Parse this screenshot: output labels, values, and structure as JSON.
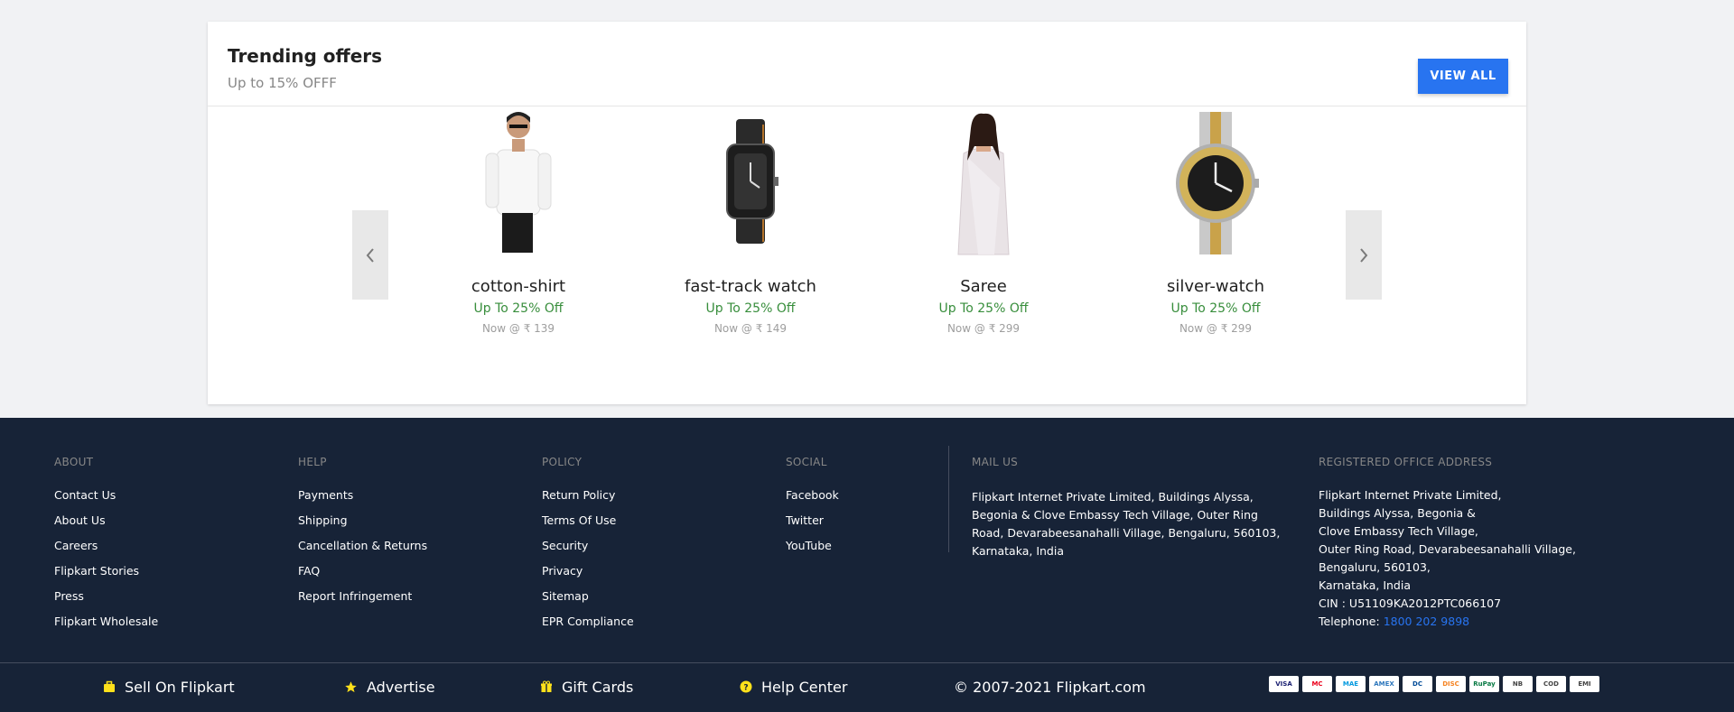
{
  "trending": {
    "title": "Trending offers",
    "subtitle": "Up to 15% OFFF",
    "view_all": "VIEW ALL",
    "products": [
      {
        "name": "cotton-shirt",
        "offer": "Up To 25% Off",
        "price": "Now @ ₹ 139"
      },
      {
        "name": "fast-track watch",
        "offer": "Up To 25% Off",
        "price": "Now @ ₹ 149"
      },
      {
        "name": "Saree",
        "offer": "Up To 25% Off",
        "price": "Now @ ₹ 299"
      },
      {
        "name": "silver-watch",
        "offer": "Up To 25% Off",
        "price": "Now @ ₹ 299"
      }
    ]
  },
  "footer": {
    "about": {
      "heading": "ABOUT",
      "links": [
        "Contact Us",
        "About Us",
        "Careers",
        "Flipkart Stories",
        "Press",
        "Flipkart Wholesale"
      ]
    },
    "help": {
      "heading": "HELP",
      "links": [
        "Payments",
        "Shipping",
        "Cancellation & Returns",
        "FAQ",
        "Report Infringement"
      ]
    },
    "policy": {
      "heading": "POLICY",
      "links": [
        "Return Policy",
        "Terms Of Use",
        "Security",
        "Privacy",
        "Sitemap",
        "EPR Compliance"
      ]
    },
    "social": {
      "heading": "SOCIAL",
      "links": [
        "Facebook",
        "Twitter",
        "YouTube"
      ]
    },
    "mail": {
      "heading": "MAIL US",
      "lines": [
        "Flipkart Internet Private Limited, Buildings Alyssa,",
        "Begonia & Clove Embassy Tech Village, Outer Ring",
        "Road, Devarabeesanahalli Village, Bengaluru, 560103,",
        "Karnataka, India"
      ]
    },
    "office": {
      "heading": "REGISTERED OFFICE ADDRESS",
      "lines": [
        "Flipkart Internet Private Limited,",
        "Buildings Alyssa, Begonia &",
        "Clove Embassy Tech Village,",
        "Outer Ring Road, Devarabeesanahalli Village,",
        "Bengaluru, 560103,",
        "Karnataka, India",
        "CIN : U51109KA2012PTC066107"
      ],
      "telephone_label": "Telephone:",
      "telephone": "1800 202 9898"
    },
    "bottom": {
      "sell": "Sell On Flipkart",
      "advertise": "Advertise",
      "gift_cards": "Gift Cards",
      "help_center": "Help Center",
      "copyright": "© 2007-2021 Flipkart.com"
    },
    "payment_methods": [
      "VISA",
      "MC",
      "MAE",
      "AMEX",
      "DC",
      "DISC",
      "RuPay",
      "NB",
      "COD",
      "EMI"
    ]
  },
  "colors": {
    "accent": "#2874f0",
    "offer_green": "#388e3c",
    "footer_bg": "#172337",
    "icon_yellow": "#ffe11b"
  }
}
